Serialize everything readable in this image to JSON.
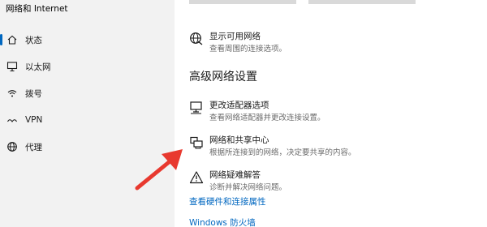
{
  "sidebar": {
    "title": "网络和 Internet",
    "items": [
      {
        "label": "状态",
        "icon": "home-icon",
        "selected": true
      },
      {
        "label": "以太网",
        "icon": "ethernet-icon"
      },
      {
        "label": "拨号",
        "icon": "dialup-icon"
      },
      {
        "label": "VPN",
        "icon": "vpn-icon"
      },
      {
        "label": "代理",
        "icon": "globe-icon"
      }
    ]
  },
  "main": {
    "show_networks": {
      "title": "显示可用网络",
      "desc": "查看周围的连接选项。",
      "icon": "globe-icon"
    },
    "section_heading": "高级网络设置",
    "adapter_options": {
      "title": "更改适配器选项",
      "desc": "查看网络适配器并更改连接设置。",
      "icon": "monitor-network-icon"
    },
    "sharing_center": {
      "title": "网络和共享中心",
      "desc": "根据所连接到的网络，决定要共享的内容。",
      "icon": "printer-network-icon"
    },
    "troubleshooter": {
      "title": "网络疑难解答",
      "desc": "诊断并解决网络问题。",
      "icon": "warning-icon"
    },
    "links": {
      "hardware_properties": "查看硬件和连接属性",
      "firewall": "Windows 防火墙"
    }
  },
  "colors": {
    "accent": "#0067c0",
    "annotation_arrow": "#e8392f",
    "sidebar_bg": "#f2f2f2"
  }
}
